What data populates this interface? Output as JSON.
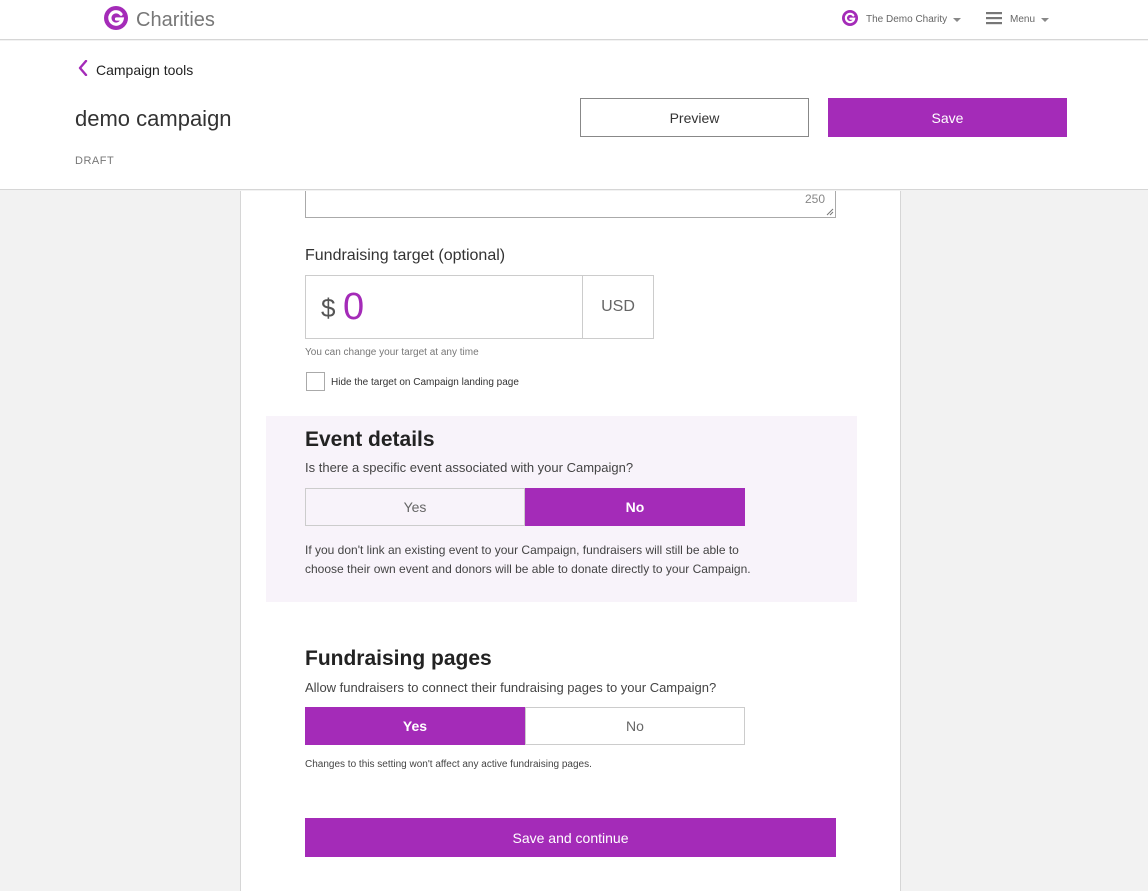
{
  "nav": {
    "brand_name": "Charities",
    "charity_name": "The Demo Charity",
    "menu_label": "Menu"
  },
  "header": {
    "back_label": "Campaign tools",
    "campaign_title": "demo campaign",
    "status": "DRAFT",
    "preview_label": "Preview",
    "save_label": "Save"
  },
  "summary": {
    "char_count": "250"
  },
  "target": {
    "label": "Fundraising target (optional)",
    "currency_symbol": "$",
    "amount": "0",
    "currency_code": "USD",
    "hint": "You can change your target at any time",
    "hide_label": "Hide the target on Campaign landing page",
    "hide_checked": false
  },
  "event": {
    "title": "Event details",
    "question": "Is there a specific event associated with your Campaign?",
    "options": [
      "Yes",
      "No"
    ],
    "selected": "No",
    "note": "If you don't link an existing event to your Campaign, fundraisers will still be able to choose their own event and donors will be able to donate directly to your Campaign."
  },
  "pages": {
    "title": "Fundraising pages",
    "question": "Allow fundraisers to connect their fundraising pages to your Campaign?",
    "options": [
      "Yes",
      "No"
    ],
    "selected": "Yes",
    "note": "Changes to this setting won't affect any active fundraising pages."
  },
  "footer": {
    "continue_label": "Save and continue"
  },
  "colors": {
    "accent": "#a42bb8",
    "event_bg": "#f8f3fa"
  },
  "icons": {
    "brand": "g-logo-icon",
    "charity": "g-logo-icon",
    "menu": "hamburger-icon",
    "back": "chevron-left-icon"
  }
}
